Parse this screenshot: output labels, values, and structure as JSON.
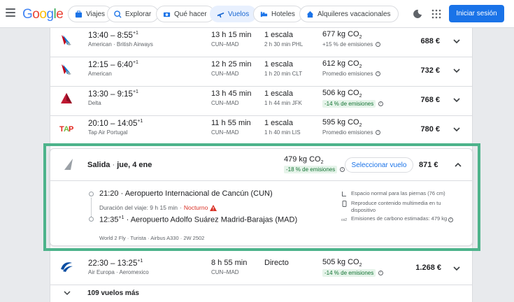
{
  "header": {
    "logo": "Google",
    "nav": [
      {
        "label": "Viajes"
      },
      {
        "label": "Explorar"
      },
      {
        "label": "Qué hacer"
      },
      {
        "label": "Vuelos"
      },
      {
        "label": "Hoteles"
      },
      {
        "label": "Alquileres vacacionales"
      }
    ],
    "signin": "Iniciar sesión"
  },
  "colors": {
    "accent": "#1a73e8",
    "highlight": "#4db38b",
    "green_badge_text": "#137333",
    "warning": "#d93025"
  },
  "flights": [
    {
      "times": "13:40 – 8:55",
      "plus": "+1",
      "airline": "American · British Airways",
      "duration": "13 h 15 min",
      "route": "CUN–MAD",
      "stops": "1 escala",
      "stop_info": "2 h 30 min PHL",
      "co2": "677 kg CO",
      "co2_sub": "2",
      "co2_note": "+15 % de emisiones",
      "price": "688 €",
      "logo": "american-airlines-logo"
    },
    {
      "times": "12:15 – 6:40",
      "plus": "+1",
      "airline": "American",
      "duration": "12 h 25 min",
      "route": "CUN–MAD",
      "stops": "1 escala",
      "stop_info": "1 h 20 min CLT",
      "co2": "612 kg CO",
      "co2_sub": "2",
      "co2_note": "Promedio emisiones",
      "price": "732 €",
      "logo": "american-airlines-logo"
    },
    {
      "times": "13:30 – 9:15",
      "plus": "+1",
      "airline": "Delta",
      "duration": "13 h 45 min",
      "route": "CUN–MAD",
      "stops": "1 escala",
      "stop_info": "1 h 44 min JFK",
      "co2": "506 kg CO",
      "co2_sub": "2",
      "co2_note": "-14 % de emisiones",
      "price": "768 €",
      "logo": "delta-logo"
    },
    {
      "times": "20:10 – 14:05",
      "plus": "+1",
      "airline": "Tap Air Portugal",
      "duration": "11 h 55 min",
      "route": "CUN–MAD",
      "stops": "1 escala",
      "stop_info": "1 h 40 min LIS",
      "co2": "595 kg CO",
      "co2_sub": "2",
      "co2_note": "Promedio emisiones",
      "price": "780 €",
      "logo": "tap-logo"
    }
  ],
  "expanded": {
    "title": "Salida",
    "date": "jue, 4 ene",
    "co2": "479 kg CO",
    "co2_sub": "2",
    "co2_note": "-18 % de emisiones",
    "select": "Seleccionar vuelo",
    "price": "871 €",
    "dep_time": "21:20",
    "dep_airport": "Aeropuerto Internacional de Cancún (CUN)",
    "travel": "Duración del viaje: 9 h 15 min",
    "night": "Nocturno",
    "arr_time": "12:35",
    "arr_plus": "+1",
    "arr_airport": "Aeropuerto Adolfo Suárez Madrid-Barajas (MAD)",
    "footer": "World 2 Fly · Turista · Airbus A330 · 2W 2502",
    "extras": [
      "Espacio normal para las piernas (76 cm)",
      "Reproduce contenido multimedia en tu dispositivo",
      "Emisiones de carbono estimadas: 479 kg"
    ]
  },
  "last_flight": {
    "times": "22:30 – 13:25",
    "plus": "+1",
    "airline": "Air Europa · Aeromexico",
    "duration": "8 h 55 min",
    "route": "CUN–MAD",
    "stops": "Directo",
    "co2": "505 kg CO",
    "co2_sub": "2",
    "co2_note": "-14 % de emisiones",
    "price": "1.268 €"
  },
  "more": "109 vuelos más"
}
